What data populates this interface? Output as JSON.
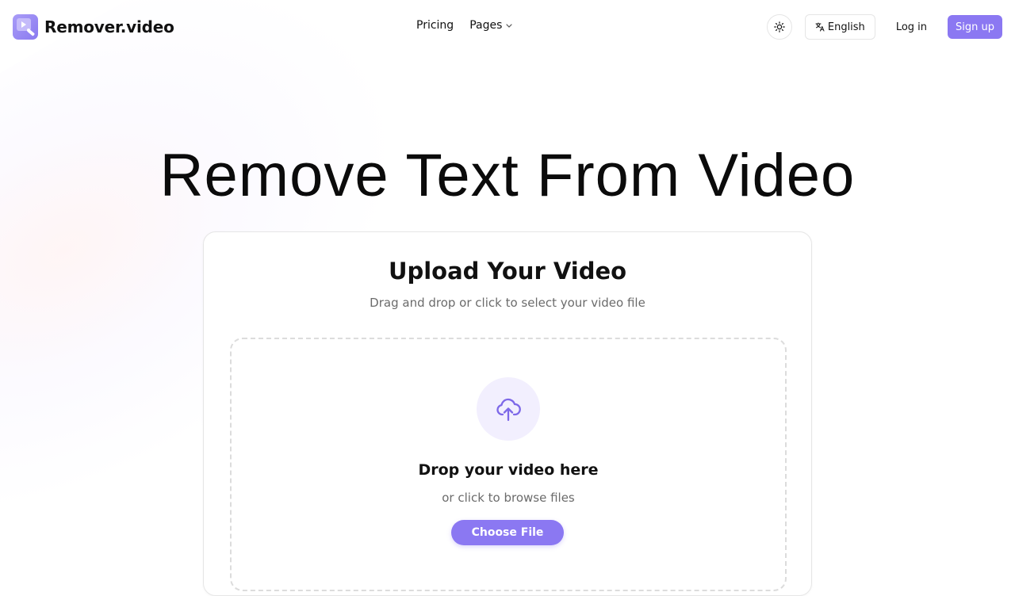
{
  "brand": {
    "name": "Remover.video",
    "accent_color": "#8b78f2",
    "logo_icon": "play-wand-icon"
  },
  "nav": {
    "items": [
      {
        "label": "Pricing"
      },
      {
        "label": "Pages",
        "icon": "chevron-down-icon"
      }
    ]
  },
  "actions": {
    "theme_icon": "sun-icon",
    "language_icon": "translate-icon",
    "language_label": "English",
    "login_label": "Log in",
    "signup_label": "Sign up"
  },
  "hero": {
    "title": "Remove Text From Video"
  },
  "upload_card": {
    "title": "Upload Your Video",
    "subtitle": "Drag and drop or click to select your video file",
    "dropzone": {
      "icon": "cloud-upload-icon",
      "title": "Drop your video here",
      "subtitle": "or click to browse files",
      "button_label": "Choose File"
    }
  }
}
